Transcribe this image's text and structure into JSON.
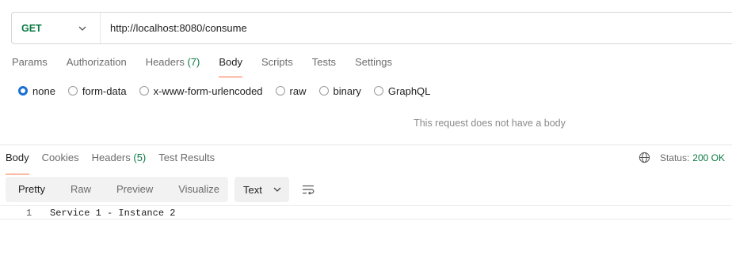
{
  "request": {
    "method": "GET",
    "url": "http://localhost:8080/consume",
    "tabs": [
      {
        "label": "Params"
      },
      {
        "label": "Authorization"
      },
      {
        "label": "Headers",
        "count": "(7)"
      },
      {
        "label": "Body"
      },
      {
        "label": "Scripts"
      },
      {
        "label": "Tests"
      },
      {
        "label": "Settings"
      }
    ],
    "active_tab": "Body",
    "body_types": [
      {
        "label": "none"
      },
      {
        "label": "form-data"
      },
      {
        "label": "x-www-form-urlencoded"
      },
      {
        "label": "raw"
      },
      {
        "label": "binary"
      },
      {
        "label": "GraphQL"
      }
    ],
    "selected_body_type": "none",
    "empty_message": "This request does not have a body"
  },
  "response": {
    "tabs": [
      {
        "label": "Body"
      },
      {
        "label": "Cookies"
      },
      {
        "label": "Headers",
        "count": "(5)"
      },
      {
        "label": "Test Results"
      }
    ],
    "active_tab": "Body",
    "status_label": "Status:",
    "status_value": "200 OK",
    "views": [
      {
        "label": "Pretty"
      },
      {
        "label": "Raw"
      },
      {
        "label": "Preview"
      },
      {
        "label": "Visualize"
      }
    ],
    "active_view": "Pretty",
    "format": "Text",
    "lines": [
      {
        "num": "1",
        "text": "Service 1 - Instance 2"
      }
    ]
  },
  "colors": {
    "accent": "#ff6c37",
    "method_get": "#0c7a43",
    "radio_selected": "#1a6fd6",
    "status_ok": "#0c7a43"
  },
  "icons": {
    "method_dropdown": "chevron-down-icon",
    "globe": "globe-icon",
    "format_dropdown": "chevron-down-icon",
    "wrap": "wrap-lines-icon"
  }
}
